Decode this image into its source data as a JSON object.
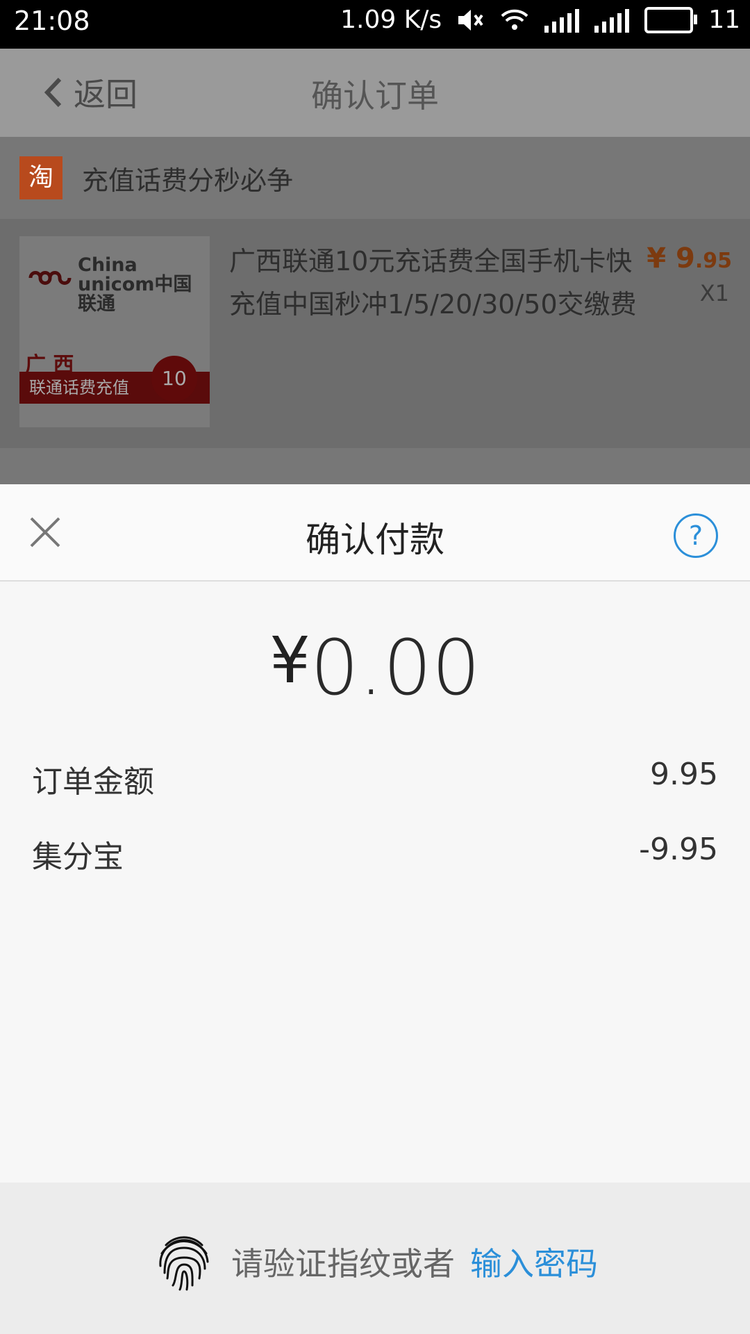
{
  "status_bar": {
    "time": "21:08",
    "speed": "1.09 K/s",
    "battery": "11"
  },
  "nav": {
    "back_label": "返回",
    "title": "确认订单"
  },
  "shop": {
    "logo_char": "淘",
    "name": "充值话费分秒必争"
  },
  "item": {
    "brand_line1": "China",
    "brand_line2": "unicom中国联通",
    "region": "广 西",
    "ribbon": "联通话费充值",
    "seal": "10",
    "title": "广西联通10元充话费全国手机卡快充值中国秒冲1/5/20/30/50交缴费",
    "price_symbol": "¥",
    "price_int": "9",
    "price_dec": ".95",
    "quantity": "X1"
  },
  "payment_sheet": {
    "title": "确认付款",
    "amount_symbol": "¥",
    "amount": "0.00",
    "rows": [
      {
        "label": "订单金额",
        "value": "9.95"
      },
      {
        "label": "集分宝",
        "value": "-9.95"
      }
    ],
    "fingerprint_prompt": "请验证指纹或者",
    "password_link": "输入密码"
  },
  "colors": {
    "accent": "#2b8fd9",
    "price": "#ff6a00"
  }
}
